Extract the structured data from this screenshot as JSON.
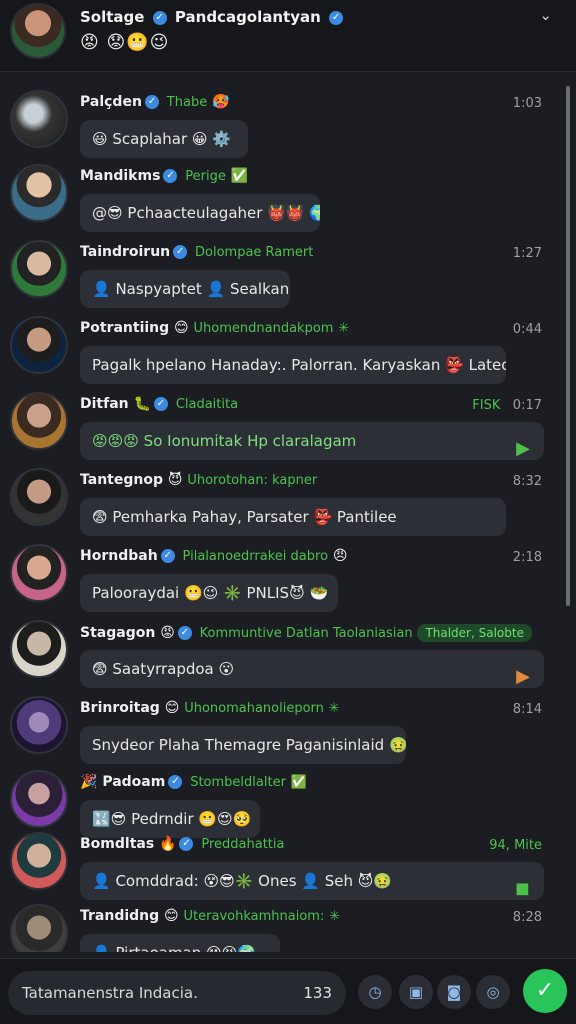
{
  "header": {
    "title": "Soltage",
    "title_rest": "Pandcagolantyan",
    "emojis": "😡 😟😬😉",
    "chevron": "⌄"
  },
  "messages": [
    {
      "name": "Palçden",
      "status": "Thabe",
      "emoji": "🥵",
      "time": "1:03",
      "text": "😃 Scaplahar 😀 ⚙️"
    },
    {
      "name": "Mandikms",
      "status": "Perige",
      "emoji": "✅",
      "time": "",
      "text": "@😎 Pchaacteulagaher 👹👹 🌍"
    },
    {
      "name": "Taindroirun",
      "status": "Dolompae Ramert",
      "emoji": "",
      "time": "1:27",
      "text": "👤 Naspyaptet 👤 Sealkan"
    },
    {
      "name": "Potrantiing",
      "status": "Uhomendnandakpom",
      "emoji": "😊",
      "time": "0:44",
      "text": "Pagalk hpelano Hanaday:. Palorran. Karyaskan 👺 Lateonc"
    },
    {
      "name": "Ditfan",
      "status": "Cladaitita",
      "emoji": "🐛",
      "time": "0:17",
      "tag": "FISK",
      "text": "😡😡😡 So Ionumitak Hp claralagam"
    },
    {
      "name": "Tantegnop",
      "status": "Uhorotohan: kapner",
      "emoji": "😈",
      "time": "8:32",
      "text": "😨 Pemharka Pahay, Parsater 👺 Pantilee"
    },
    {
      "name": "Horndbah",
      "status": "Pilalanoedrrakei dabro",
      "emoji": "😠",
      "time": "2:18",
      "text": "Palooraydai 😬😉 ✳️ PNLIS😈 🥗"
    },
    {
      "name": "Stagagon",
      "status": "Kommuntive Datlan Taolaniasian",
      "emoji": "😡",
      "time": "",
      "tag": "Thalder, Salobte",
      "text": "😨 Saatyrrapdoa 😮"
    },
    {
      "name": "Brinroitag",
      "status": "Uhonomahanolieporn",
      "emoji": "😊",
      "time": "8:14",
      "text": "Snydeor Plaha Themagre Paganisinlaid 🤢"
    },
    {
      "name": "Padoam",
      "status": "Stombeldlalter",
      "emoji": "🎉",
      "time": "",
      "text": "🔣😎 Pedrndir 😬😍🥺"
    },
    {
      "name": "Bomdltas",
      "status": "Preddahattia",
      "emoji": "🔥",
      "time": "94, Mite",
      "text": "👤 Comddrad: 😵😎✳️ Ones 👤 Seh 😈🤢"
    },
    {
      "name": "Trandidng",
      "status": "Uteravohkamhnaiom:",
      "emoji": "😊",
      "time": "8:28",
      "text": "👤 Pirtaoaman 😵😫🌍"
    }
  ],
  "composer": {
    "placeholder": "Tatamanenstra Indacia.",
    "counter": "133",
    "send_icon": "✓",
    "buttons": [
      "clock-icon",
      "gallery-icon",
      "camera-icon",
      "compass-icon"
    ]
  }
}
